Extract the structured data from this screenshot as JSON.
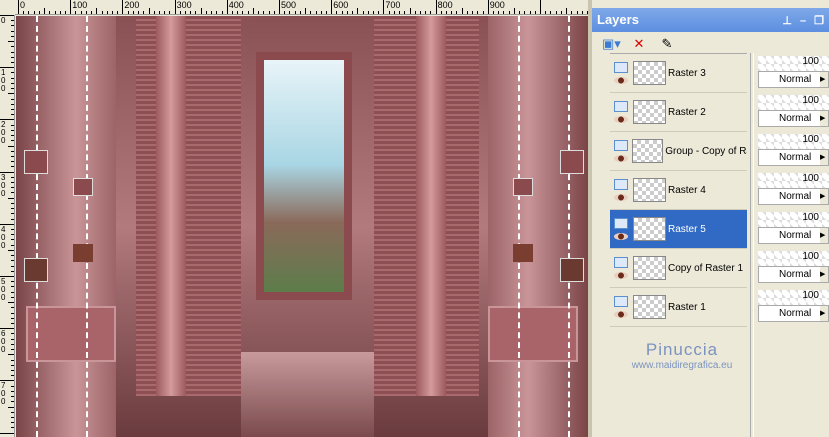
{
  "ruler": {
    "top_labels": [
      "0",
      "100",
      "200",
      "300",
      "400",
      "500",
      "600",
      "700",
      "800",
      "900"
    ],
    "left_labels": [
      "0",
      "100",
      "200",
      "300",
      "400",
      "500",
      "600",
      "700"
    ]
  },
  "panel": {
    "title": "Layers",
    "controls": [
      "pin-icon",
      "minimize-icon",
      "restore-icon"
    ],
    "toolbar": [
      "new-layer-icon",
      "delete-layer-icon",
      "edit-selection-icon"
    ]
  },
  "layers": [
    {
      "name": "Raster 3",
      "opacity": "100",
      "blend": "Normal",
      "selected": false
    },
    {
      "name": "Raster 2",
      "opacity": "100",
      "blend": "Normal",
      "selected": false
    },
    {
      "name": "Group - Copy of Ra",
      "opacity": "100",
      "blend": "Normal",
      "selected": false
    },
    {
      "name": "Raster 4",
      "opacity": "100",
      "blend": "Normal",
      "selected": false
    },
    {
      "name": "Raster 5",
      "opacity": "100",
      "blend": "Normal",
      "selected": true
    },
    {
      "name": "Copy of Raster 1",
      "opacity": "100",
      "blend": "Normal",
      "selected": false
    },
    {
      "name": "Raster 1",
      "opacity": "100",
      "blend": "Normal",
      "selected": false
    }
  ],
  "watermark": {
    "title": "Pinuccia",
    "url": "www.maidiregrafica.eu"
  },
  "colors": {
    "selection": "#316ac5",
    "accent": "#b27a7c"
  }
}
